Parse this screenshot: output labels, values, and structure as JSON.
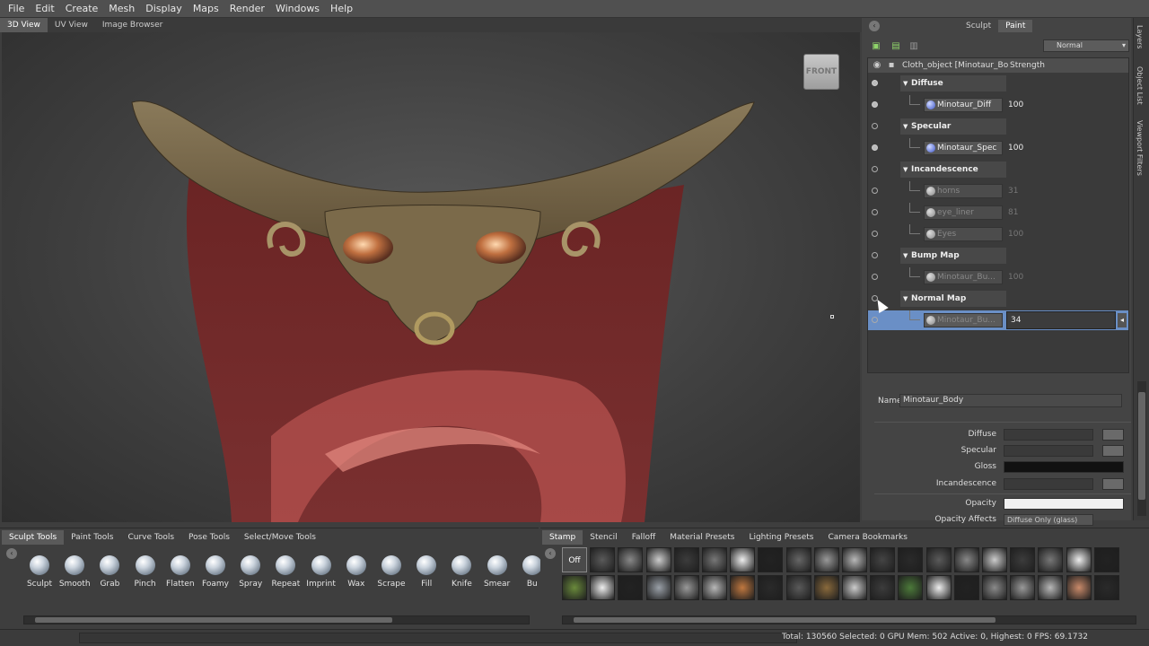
{
  "menubar": {
    "items": [
      "File",
      "Edit",
      "Create",
      "Mesh",
      "Display",
      "Maps",
      "Render",
      "Windows",
      "Help"
    ]
  },
  "viewtabs": [
    "3D View",
    "UV View",
    "Image Browser"
  ],
  "viewport": {
    "viewcube_label": "FRONT"
  },
  "right_panel": {
    "tabs": [
      "Sculpt",
      "Paint"
    ],
    "blend_mode": "Normal",
    "layers_header": {
      "object": "Cloth_object [Minotaur_Bo",
      "strength": "Strength"
    },
    "rows": [
      {
        "type": "group",
        "label": "Diffuse"
      },
      {
        "type": "layer",
        "label": "Minotaur_Diff",
        "value": "100",
        "dim": false
      },
      {
        "type": "group",
        "label": "Specular"
      },
      {
        "type": "layer",
        "label": "Minotaur_Spec",
        "value": "100",
        "dim": false
      },
      {
        "type": "group",
        "label": "Incandescence"
      },
      {
        "type": "layer",
        "label": "horns",
        "value": "31",
        "dim": true
      },
      {
        "type": "layer",
        "label": "eye_liner",
        "value": "81",
        "dim": true
      },
      {
        "type": "layer",
        "label": "Eyes",
        "value": "100",
        "dim": true
      },
      {
        "type": "group",
        "label": "Bump Map"
      },
      {
        "type": "layer",
        "label": "Minotaur_Bu...",
        "value": "100",
        "dim": true
      },
      {
        "type": "group",
        "label": "Normal Map"
      },
      {
        "type": "layer",
        "label": "Minotaur_Bu...",
        "value": "34",
        "dim": false,
        "selected": true
      }
    ],
    "properties": {
      "name_label": "Name",
      "name_value": "Minotaur_Body",
      "diffuse": "Diffuse",
      "specular": "Specular",
      "gloss": "Gloss",
      "incandescence": "Incandescence",
      "opacity": "Opacity",
      "opacity_affects": "Opacity Affects",
      "opacity_affects_value": "Diffuse Only (glass)"
    }
  },
  "side_tabs": [
    "Layers",
    "Object List",
    "Viewport Filters"
  ],
  "bottom_left": {
    "tabs": [
      "Sculpt Tools",
      "Paint Tools",
      "Curve Tools",
      "Pose Tools",
      "Select/Move Tools"
    ],
    "brushes": [
      "Sculpt",
      "Smooth",
      "Grab",
      "Pinch",
      "Flatten",
      "Foamy",
      "Spray",
      "Repeat",
      "Imprint",
      "Wax",
      "Scrape",
      "Fill",
      "Knife",
      "Smear",
      "Bu"
    ]
  },
  "bottom_right": {
    "tabs": [
      "Stamp",
      "Stencil",
      "Falloff",
      "Material Presets",
      "Lighting Presets",
      "Camera Bookmarks"
    ],
    "off_label": "Off"
  },
  "status": {
    "text": "Total: 130560  Selected: 0  GPU Mem: 502  Active: 0, Highest: 0  FPS: 69.1732"
  },
  "colors": {
    "selection": "#6a8fc6",
    "panel": "#444444",
    "cloth": "#7a2b2b",
    "metal": "#7d6a4c"
  }
}
